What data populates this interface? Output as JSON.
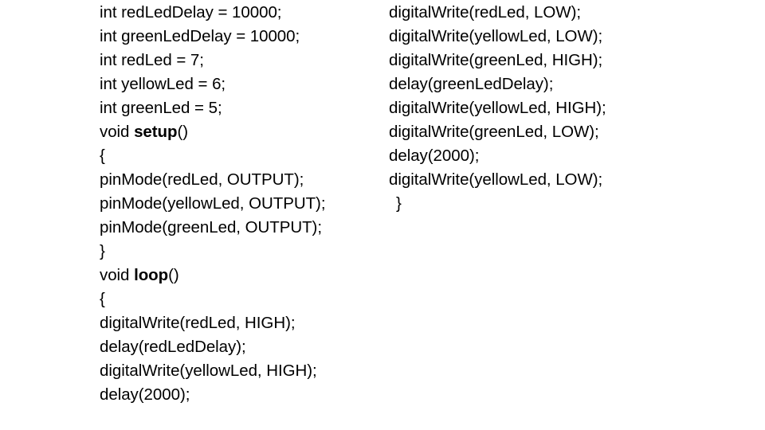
{
  "document": {
    "background_color": "#ffffff",
    "text_color": "#000000",
    "language": "arduino-c"
  },
  "code": {
    "left_column": [
      {
        "text": "int redLedDelay = 10000;",
        "bold_token": "",
        "indent": 0
      },
      {
        "text": "int greenLedDelay = 10000;",
        "bold_token": "",
        "indent": 0
      },
      {
        "text": "int redLed = 7;",
        "bold_token": "",
        "indent": 0
      },
      {
        "text": "int yellowLed = 6;",
        "bold_token": "",
        "indent": 0
      },
      {
        "text": "int greenLed = 5;",
        "bold_token": "",
        "indent": 0
      },
      {
        "text": "void setup()",
        "bold_token": "setup",
        "indent": 0
      },
      {
        "text": "{",
        "bold_token": "",
        "indent": 0
      },
      {
        "text": "pinMode(redLed, OUTPUT);",
        "bold_token": "",
        "indent": 0
      },
      {
        "text": "pinMode(yellowLed, OUTPUT);",
        "bold_token": "",
        "indent": 0
      },
      {
        "text": "pinMode(greenLed, OUTPUT);",
        "bold_token": "",
        "indent": 0
      },
      {
        "text": "}",
        "bold_token": "",
        "indent": 0
      },
      {
        "text": "void loop()",
        "bold_token": "loop",
        "indent": 0
      },
      {
        "text": "{",
        "bold_token": "",
        "indent": 0
      },
      {
        "text": "digitalWrite(redLed, HIGH);",
        "bold_token": "",
        "indent": 0
      },
      {
        "text": "delay(redLedDelay);",
        "bold_token": "",
        "indent": 0
      },
      {
        "text": "digitalWrite(yellowLed, HIGH);",
        "bold_token": "",
        "indent": 0
      },
      {
        "text": "delay(2000);",
        "bold_token": "",
        "indent": 0
      }
    ],
    "right_column": [
      {
        "text": "digitalWrite(redLed, LOW);",
        "bold_token": "",
        "indent": 0
      },
      {
        "text": "digitalWrite(yellowLed, LOW);",
        "bold_token": "",
        "indent": 0
      },
      {
        "text": "digitalWrite(greenLed, HIGH);",
        "bold_token": "",
        "indent": 0
      },
      {
        "text": "delay(greenLedDelay);",
        "bold_token": "",
        "indent": 0
      },
      {
        "text": "digitalWrite(yellowLed, HIGH);",
        "bold_token": "",
        "indent": 0
      },
      {
        "text": "digitalWrite(greenLed, LOW);",
        "bold_token": "",
        "indent": 0
      },
      {
        "text": "delay(2000);",
        "bold_token": "",
        "indent": 0
      },
      {
        "text": "digitalWrite(yellowLed, LOW);",
        "bold_token": "",
        "indent": 0
      },
      {
        "text": "}",
        "bold_token": "",
        "indent": 1
      }
    ]
  }
}
